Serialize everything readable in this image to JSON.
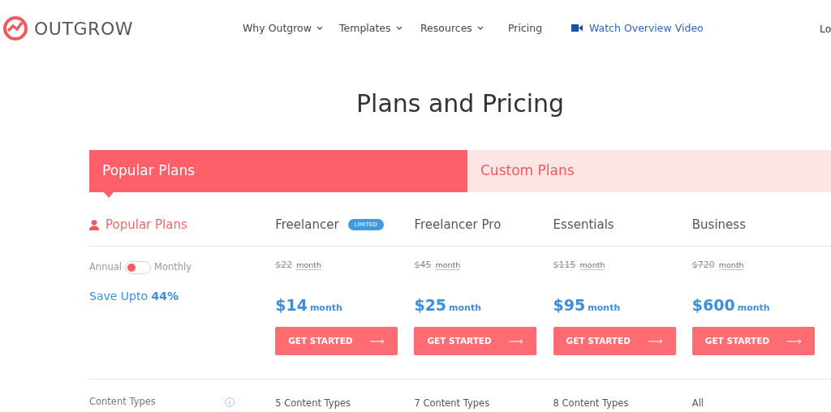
{
  "logo": {
    "text": "OUTGROW"
  },
  "nav": [
    {
      "label": "Why Outgrow",
      "dropdown": true
    },
    {
      "label": "Templates",
      "dropdown": true
    },
    {
      "label": "Resources",
      "dropdown": true
    },
    {
      "label": "Pricing",
      "dropdown": false
    }
  ],
  "video_link": {
    "label": "Watch Overview Video"
  },
  "login": {
    "label": "Lo"
  },
  "title": "Plans and Pricing",
  "tabs": [
    {
      "label": "Popular Plans",
      "selected": true
    },
    {
      "label": "Custom Plans",
      "selected": false
    }
  ],
  "side": {
    "heading": "Popular Plans",
    "billing_left": "Annual",
    "billing_right": "Monthly",
    "toggle_on": false,
    "save": "Save Upto **44%**"
  },
  "plans": [
    {
      "name": "Freelancer",
      "badge": "LIMITED",
      "old_price": "$22",
      "old_unit": "month",
      "price": "$14",
      "unit": "month",
      "button": "GET STARTED",
      "content_types": "5 Content Types"
    },
    {
      "name": "Freelancer Pro",
      "old_price": "$45",
      "old_unit": "month",
      "price": "$25",
      "unit": "month",
      "button": "GET STARTED",
      "content_types": "7 Content Types"
    },
    {
      "name": "Essentials",
      "old_price": "$115",
      "old_unit": "month",
      "price": "$95",
      "unit": "month",
      "button": "GET STARTED",
      "content_types": "8 Content Types"
    },
    {
      "name": "Business",
      "old_price": "$720",
      "old_unit": "month",
      "price": "$600",
      "unit": "month",
      "button": "GET STARTED",
      "content_types": "All"
    }
  ],
  "feature_label": "Content Types"
}
